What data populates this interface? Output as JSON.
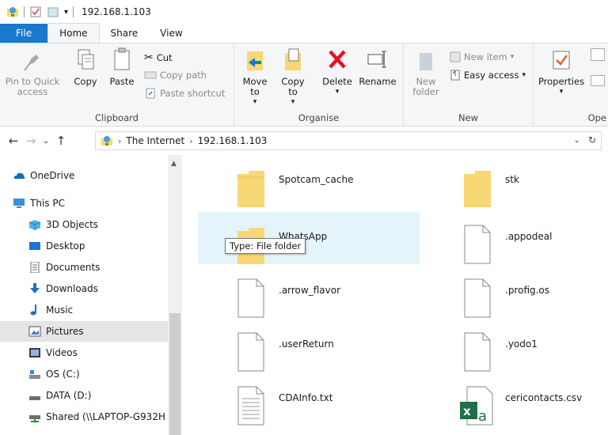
{
  "window": {
    "title": "192.168.1.103"
  },
  "tabs": [
    {
      "label": "File"
    },
    {
      "label": "Home"
    },
    {
      "label": "Share"
    },
    {
      "label": "View"
    }
  ],
  "ribbon": {
    "clipboard": {
      "label": "Clipboard",
      "pin": "Pin to Quick access",
      "copy": "Copy",
      "paste": "Paste",
      "cut": "Cut",
      "copy_path": "Copy path",
      "paste_shortcut": "Paste shortcut"
    },
    "organise": {
      "label": "Organise",
      "move_to": "Move to",
      "copy_to": "Copy to",
      "delete": "Delete",
      "rename": "Rename"
    },
    "new": {
      "label": "New",
      "new_folder": "New folder",
      "new_item": "New item",
      "easy_access": "Easy access"
    },
    "open": {
      "label": "Ope",
      "properties": "Properties"
    }
  },
  "address": {
    "crumbs": [
      "The Internet",
      "192.168.1.103"
    ]
  },
  "nav": {
    "items": [
      {
        "label": "OneDrive",
        "icon": "cloud-icon"
      },
      {
        "label": "This PC",
        "icon": "monitor-icon"
      },
      {
        "label": "3D Objects",
        "icon": "cube-icon"
      },
      {
        "label": "Desktop",
        "icon": "desktop-icon"
      },
      {
        "label": "Documents",
        "icon": "document-icon"
      },
      {
        "label": "Downloads",
        "icon": "download-icon"
      },
      {
        "label": "Music",
        "icon": "music-icon"
      },
      {
        "label": "Pictures",
        "icon": "pictures-icon"
      },
      {
        "label": "Videos",
        "icon": "video-icon"
      },
      {
        "label": "OS (C:)",
        "icon": "drive-icon"
      },
      {
        "label": "DATA (D:)",
        "icon": "drive-icon"
      },
      {
        "label": "Shared (\\\\LAPTOP-G932H",
        "icon": "network-drive-icon"
      }
    ]
  },
  "files": [
    {
      "name": "Spotcam_cache",
      "type": "folder"
    },
    {
      "name": "stk",
      "type": "folder"
    },
    {
      "name": "WhatsApp",
      "type": "folder"
    },
    {
      "name": ".appodeal",
      "type": "file"
    },
    {
      "name": ".arrow_flavor",
      "type": "file"
    },
    {
      "name": ".profig.os",
      "type": "file"
    },
    {
      "name": ".userReturn",
      "type": "file"
    },
    {
      "name": ".yodo1",
      "type": "file"
    },
    {
      "name": "CDAInfo.txt",
      "type": "text"
    },
    {
      "name": "cericontacts.csv",
      "type": "excel"
    }
  ],
  "tooltip": "Type: File folder",
  "colors": {
    "accent": "#1979ca",
    "selection": "#cce8ff",
    "hover": "#e5f3fb",
    "folder": "#f8d775"
  }
}
